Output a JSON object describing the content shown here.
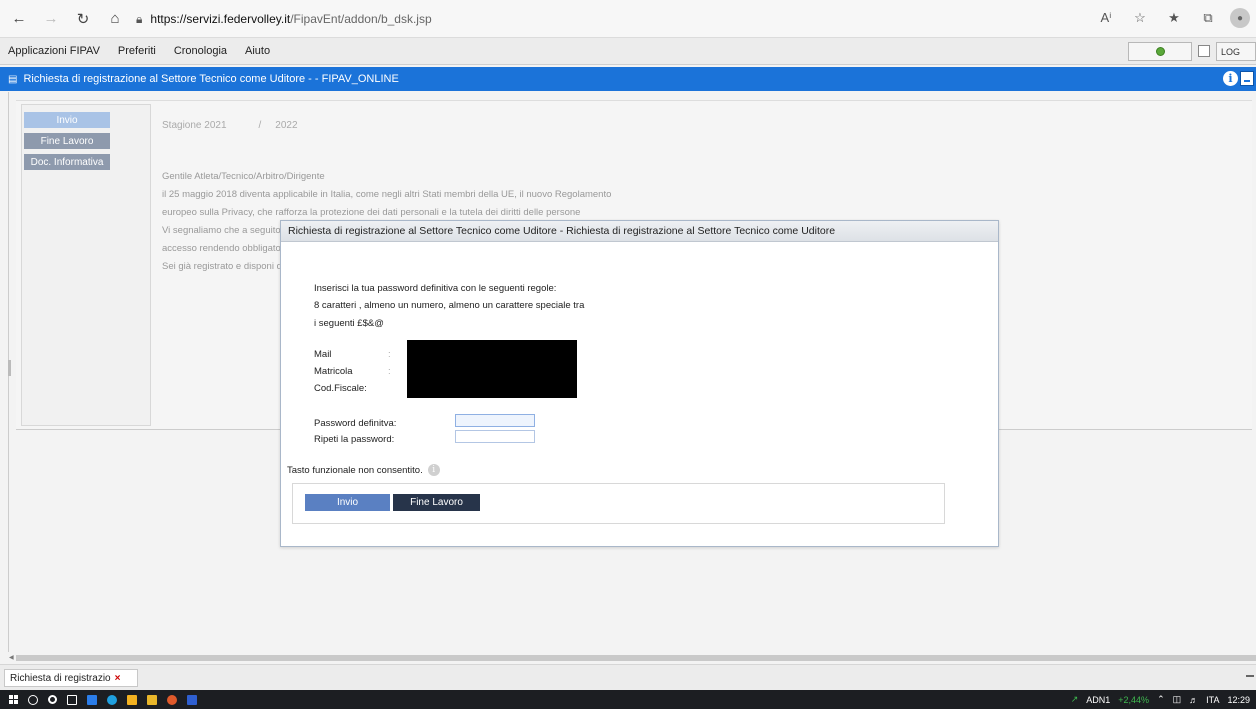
{
  "browser": {
    "url_host": "https://servizi.federvolley.it",
    "url_path": "/FipavEnt/addon/b_dsk.jsp"
  },
  "app_menu": {
    "items": [
      "Applicazioni FIPAV",
      "Preferiti",
      "Cronologia",
      "Aiuto"
    ],
    "log_label": "LOG"
  },
  "title_bar": {
    "title": "Richiesta di registrazione al Settore Tecnico come Uditore - - FIPAV_ONLINE"
  },
  "sidebar": {
    "invio": "Invio",
    "fine_lavoro": "Fine Lavoro",
    "doc_informativa": "Doc. Informativa"
  },
  "background": {
    "stagione_label": "Stagione 2021",
    "slash": "/",
    "year_end": "2022",
    "lines": [
      "Gentile Atleta/Tecnico/Arbitro/Dirigente",
      "il 25 maggio 2018 diventa applicabile in Italia, come negli altri Stati membri della UE, il nuovo Regolamento",
      "europeo sulla Privacy, che rafforza la protezione dei dati personali e la tutela dei diritti delle persone",
      "Vi segnaliamo che a seguito di",
      "accesso rendendo obbligatoria",
      "Sei già registrato e disponi dell"
    ]
  },
  "modal": {
    "title": "Richiesta di registrazione al Settore Tecnico come Uditore - Richiesta di registrazione al Settore Tecnico come Uditore",
    "instructions": [
      "Inserisci la tua password definitiva con le seguenti regole:",
      "8 caratteri , almeno un numero, almeno un carattere speciale tra",
      "i seguenti £$&@"
    ],
    "fields": {
      "mail_label": "Mail",
      "matricola_label": "Matricola",
      "codfiscale_label": "Cod.Fiscale:",
      "colon": ":",
      "password_label": "Password definitva:",
      "repeat_label": "Ripeti la password:"
    },
    "note": "Tasto funzionale non consentito.",
    "buttons": {
      "invio": "Invio",
      "fine_lavoro": "Fine Lavoro"
    }
  },
  "tabs": {
    "active_tab": "Richiesta di registrazio",
    "close": "×"
  },
  "taskbar": {
    "ticker": "ADN1",
    "change": "+2,44%",
    "lang": "ITA",
    "time": "12:29"
  },
  "colors": {
    "title_bar": "#1b73d9",
    "button_primary": "#5a80c2",
    "button_dark": "#27344a"
  }
}
